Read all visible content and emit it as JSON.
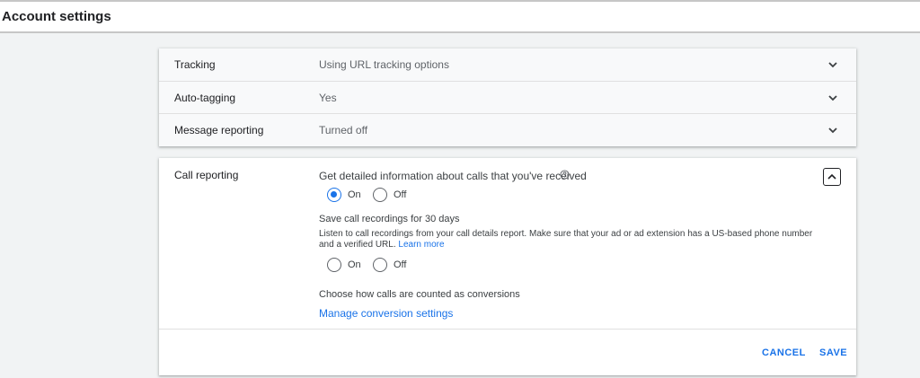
{
  "header": {
    "title": "Account settings"
  },
  "rows": [
    {
      "label": "Tracking",
      "value": "Using URL tracking options",
      "icon": "chevron-down-icon"
    },
    {
      "label": "Auto-tagging",
      "value": "Yes",
      "icon": "chevron-down-icon"
    },
    {
      "label": "Message reporting",
      "value": "Turned off",
      "icon": "chevron-down-icon"
    }
  ],
  "call_reporting": {
    "label": "Call reporting",
    "question": "Get detailed information about calls that you've received",
    "help_icon": "help-circle-icon",
    "collapse_icon": "chevron-up-icon",
    "options1": {
      "on": "On",
      "off": "Off",
      "selected": "On"
    },
    "recordings_title": "Save call recordings for 30 days",
    "recordings_desc": "Listen to call recordings from your call details report. Make sure that your ad or ad extension has a US-based phone number and a verified URL.",
    "learn_more": "Learn more",
    "options2": {
      "on": "On",
      "off": "Off",
      "selected": ""
    },
    "conversions_text": "Choose how calls are counted as conversions",
    "manage_link": "Manage conversion settings",
    "cancel_label": "CANCEL",
    "save_label": "SAVE"
  },
  "colors": {
    "accent": "#1a73e8",
    "page_bg": "#f1f3f4",
    "card_bg": "#ffffff"
  }
}
